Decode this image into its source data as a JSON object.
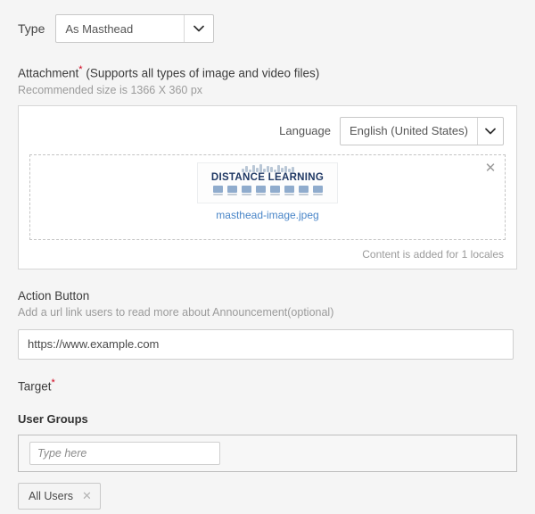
{
  "type_section": {
    "label": "Type",
    "selected": "As Masthead",
    "dropdown_icon": "chevron-down-icon"
  },
  "attachment": {
    "label": "Attachment",
    "required_marker": "*",
    "hint_inline": "(Supports all types of image and video files)",
    "recommendation": "Recommended size is 1366 X 360 px",
    "language": {
      "label": "Language",
      "selected": "English (United States)",
      "dropdown_icon": "chevron-down-icon"
    },
    "remove_icon": "close-icon",
    "thumbnail": {
      "banner_title": "DISTANCE LEARNING",
      "file_name": "masthead-image.jpeg"
    },
    "footer_text": "Content is added for 1 locales"
  },
  "action_button": {
    "label": "Action Button",
    "hint": "Add a url link users to read more about Announcement(optional)",
    "url_value": "https://www.example.com",
    "url_placeholder": ""
  },
  "target": {
    "label": "Target",
    "required_marker": "*",
    "user_groups_label": "User Groups",
    "input_placeholder": "Type here",
    "input_value": "",
    "chips": [
      {
        "label": "All Users",
        "remove_icon": "close-icon"
      }
    ]
  },
  "colors": {
    "page_background": "#f5f5f5",
    "panel_background": "#ffffff",
    "required_red": "#d0021b",
    "link_blue": "#4a86c8",
    "muted_text": "#9b9b9b",
    "banner_navy": "#1f3864"
  }
}
